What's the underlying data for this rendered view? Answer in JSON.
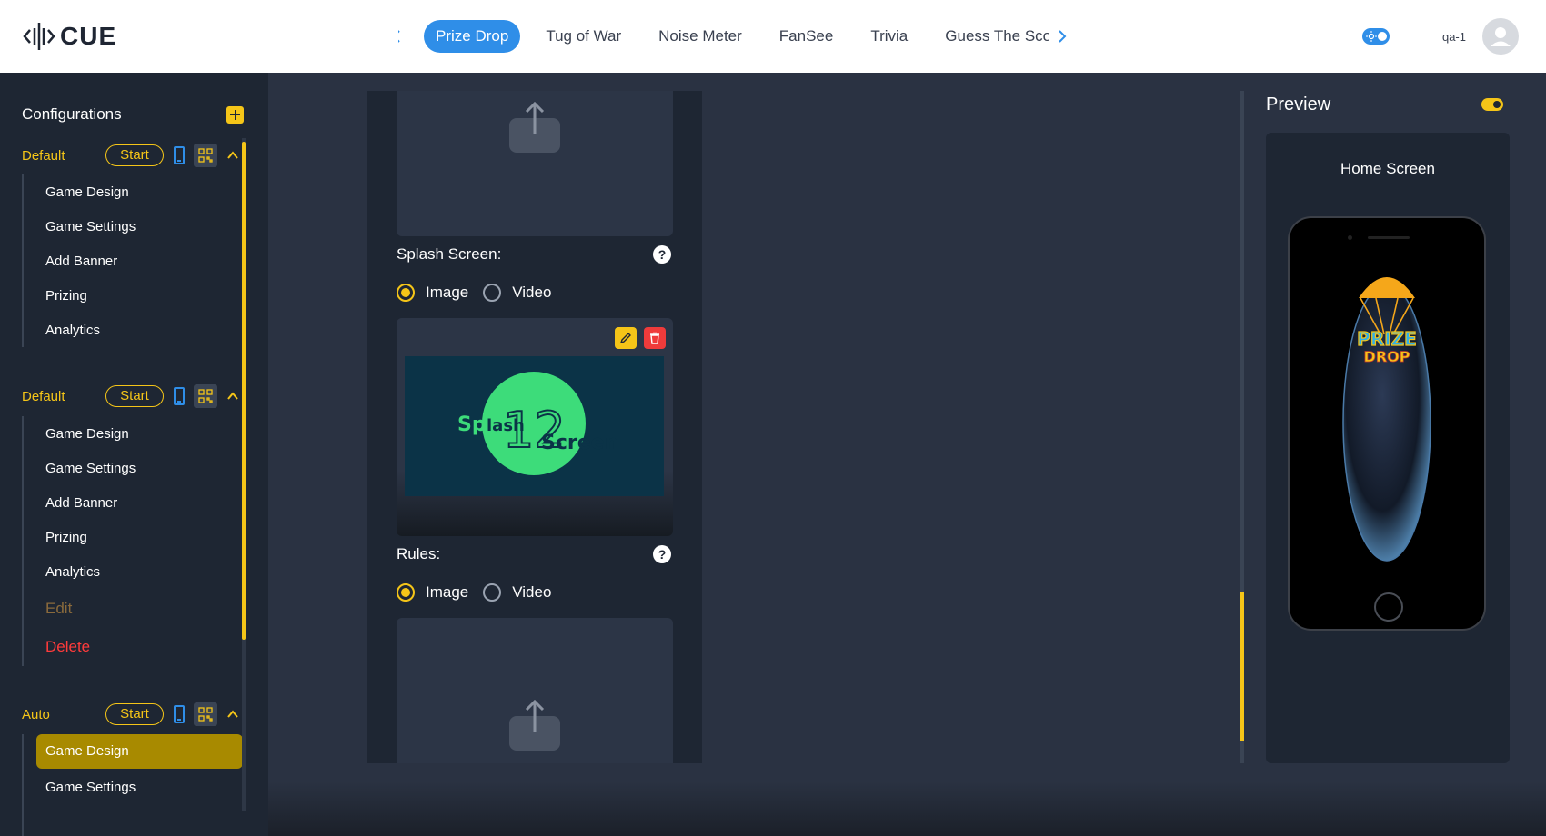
{
  "brand": {
    "name": "CUE"
  },
  "tabs": {
    "items": [
      "Prize Drop",
      "Tug of War",
      "Noise Meter",
      "FanSee",
      "Trivia",
      "Guess The Sco"
    ],
    "active": "Prize Drop"
  },
  "user": {
    "name": "qa-1"
  },
  "sidebar": {
    "title": "Configurations",
    "configs": [
      {
        "name": "Default",
        "start_label": "Start",
        "items": [
          "Game Design",
          "Game Settings",
          "Add Banner",
          "Prizing",
          "Analytics"
        ]
      },
      {
        "name": "Default",
        "start_label": "Start",
        "items": [
          "Game Design",
          "Game Settings",
          "Add Banner",
          "Prizing",
          "Analytics"
        ],
        "edit_label": "Edit",
        "delete_label": "Delete"
      },
      {
        "name": "Auto",
        "start_label": "Start",
        "items": [
          "Game Design",
          "Game Settings"
        ],
        "selected": "Game Design"
      }
    ]
  },
  "main": {
    "splash": {
      "label": "Splash Screen:",
      "help": "?",
      "options": [
        "Image",
        "Video"
      ],
      "selected": "Image",
      "image_text": {
        "part1": "Sp",
        "part2": "lash",
        "part3": "Screen",
        "number": "12"
      }
    },
    "rules": {
      "label": "Rules:",
      "help": "?",
      "options": [
        "Image",
        "Video"
      ],
      "selected": "Image"
    }
  },
  "preview": {
    "title": "Preview",
    "screen_label": "Home Screen",
    "logo_line1": "PRIZE",
    "logo_line2": "DROP"
  },
  "colors": {
    "accent": "#f5c518",
    "primary": "#2f8ee8",
    "danger": "#ef3b3b",
    "bg": "#2a3242",
    "panel": "#1e2633"
  }
}
